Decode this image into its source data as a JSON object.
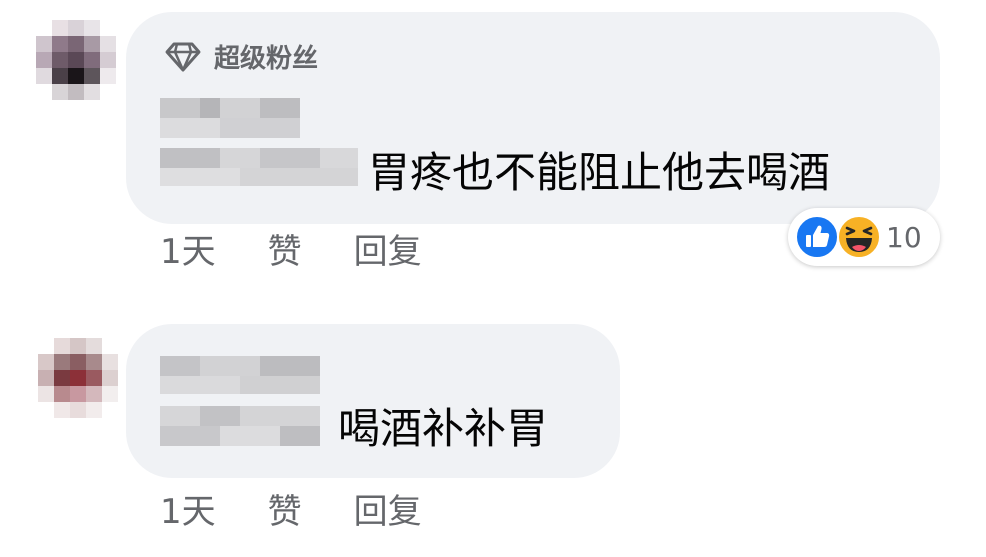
{
  "comments": [
    {
      "badge_label": "超级粉丝",
      "badge_icon": "diamond-icon",
      "author_name_redacted": true,
      "text": "胃疼也不能阻止他去喝酒",
      "time": "1天",
      "like_label": "赞",
      "reply_label": "回复",
      "reactions": {
        "icons": [
          "like-reaction-icon",
          "haha-reaction-icon"
        ],
        "count": "10"
      }
    },
    {
      "author_name_redacted": true,
      "text": "喝酒补补胃",
      "time": "1天",
      "like_label": "赞",
      "reply_label": "回复"
    }
  ],
  "colors": {
    "bubble": "#f0f2f5",
    "secondary_text": "#65676b",
    "primary_text": "#050505",
    "like_blue": "#1877f2",
    "haha_yellow": "#f7b125"
  }
}
